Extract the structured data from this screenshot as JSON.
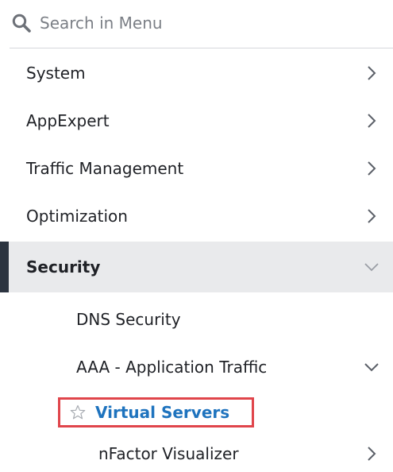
{
  "search": {
    "placeholder": "Search in Menu",
    "icon": "search-icon"
  },
  "menu": {
    "items": [
      {
        "label": "System",
        "icon": "chevron-right-icon"
      },
      {
        "label": "AppExpert",
        "icon": "chevron-right-icon"
      },
      {
        "label": "Traffic Management",
        "icon": "chevron-right-icon"
      },
      {
        "label": "Optimization",
        "icon": "chevron-right-icon"
      },
      {
        "label": "Security",
        "icon": "chevron-down-icon",
        "expanded": true
      }
    ],
    "security_children": [
      {
        "label": "DNS Security"
      },
      {
        "label": "AAA - Application Traffic",
        "icon": "chevron-down-icon",
        "expanded": true
      }
    ],
    "aaa_children": [
      {
        "label": "Virtual Servers",
        "icon": "star-outline-icon",
        "highlighted": true
      },
      {
        "label": "nFactor Visualizer",
        "icon": "chevron-right-icon"
      }
    ]
  },
  "colors": {
    "selected_background": "#e9eaec",
    "selected_bar": "#2c3440",
    "link_blue": "#1e73be",
    "highlight_border": "#e0454b",
    "text": "#1f2126",
    "muted_text": "#7b7f86"
  }
}
